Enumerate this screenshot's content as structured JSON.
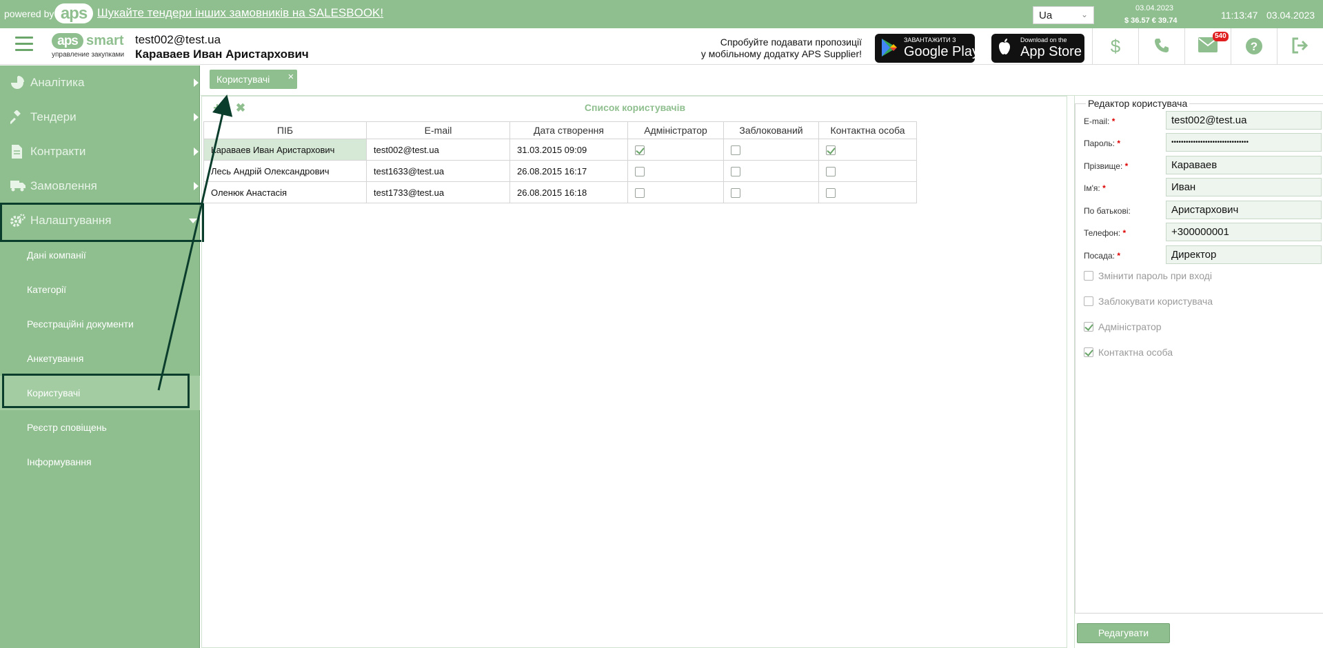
{
  "topbar": {
    "powered_by": "powered by",
    "logo_text": "aps",
    "promo_link": "Шукайте тендери інших замовників на SALESBOOK!",
    "language": "Ua",
    "rates_date": "03.04.2023",
    "rates": "$ 36.57  € 39.74",
    "time": "11:13:47",
    "date": "03.04.2023"
  },
  "header": {
    "logo_short": "aps",
    "logo_smart": "smart",
    "logo_tagline": "управление закупками",
    "user_email": "test002@test.ua",
    "user_name": "Караваев Иван Аристархович",
    "mobile_promo_line1": "Спробуйте подавати пропозиції",
    "mobile_promo_line2": "у мобільному додатку APS Supplier!",
    "google_play_small": "ЗАВАНТАЖИТИ З",
    "google_play_big": "Google Play",
    "app_store_small": "Download on the",
    "app_store_big": "App Store",
    "mail_badge": "540"
  },
  "sidebar": {
    "items": [
      {
        "label": "Аналітика",
        "icon": "pie-chart-icon"
      },
      {
        "label": "Тендери",
        "icon": "gavel-icon"
      },
      {
        "label": "Контракти",
        "icon": "document-icon"
      },
      {
        "label": "Замовлення",
        "icon": "truck-icon"
      },
      {
        "label": "Налаштування",
        "icon": "gears-icon"
      }
    ],
    "subitems": [
      {
        "label": "Дані компанії"
      },
      {
        "label": "Категорії"
      },
      {
        "label": "Реєстраційні документи"
      },
      {
        "label": "Анкетування"
      },
      {
        "label": "Користувачі"
      },
      {
        "label": "Реєстр сповіщень"
      },
      {
        "label": "Інформування"
      }
    ]
  },
  "tab": {
    "label": "Користувачі",
    "close": "×"
  },
  "list": {
    "title": "Список користувачів",
    "columns": [
      "ПІБ",
      "E-mail",
      "Дата створення",
      "Адміністратор",
      "Заблокований",
      "Контактна особа"
    ],
    "rows": [
      {
        "name": "Караваев Иван Аристархович",
        "email": "test002@test.ua",
        "created": "31.03.2015 09:09",
        "admin": true,
        "blocked": false,
        "contact": true
      },
      {
        "name": "Лесь Андрій Олександрович",
        "email": "test1633@test.ua",
        "created": "26.08.2015 16:17",
        "admin": false,
        "blocked": false,
        "contact": false
      },
      {
        "name": "Оленюк Анастасія",
        "email": "test1733@test.ua",
        "created": "26.08.2015 16:18",
        "admin": false,
        "blocked": false,
        "contact": false
      }
    ]
  },
  "editor": {
    "legend": "Редактор користувача",
    "fields": [
      {
        "label": "E-mail:",
        "required": true,
        "value": "test002@test.ua"
      },
      {
        "label": "Пароль:",
        "required": true,
        "value": "••••••••••••••••••••••••••••••••"
      },
      {
        "label": "Прізвище:",
        "required": true,
        "value": "Караваев"
      },
      {
        "label": "Ім'я:",
        "required": true,
        "value": "Иван"
      },
      {
        "label": "По батькові:",
        "required": false,
        "value": "Аристархович"
      },
      {
        "label": "Телефон:",
        "required": true,
        "value": "+300000001"
      },
      {
        "label": "Посада:",
        "required": true,
        "value": "Директор"
      }
    ],
    "checkboxes": [
      {
        "label": "Змінити пароль при вході",
        "checked": false
      },
      {
        "label": "Заблокувати користувача",
        "checked": false
      },
      {
        "label": "Адміністратор",
        "checked": true
      },
      {
        "label": "Контактна особа",
        "checked": true
      }
    ],
    "edit_button": "Редагувати"
  },
  "colors": {
    "brand_green": "#8fbf8f",
    "highlight_dark": "#0b3d2c",
    "badge_red": "#e02020"
  }
}
